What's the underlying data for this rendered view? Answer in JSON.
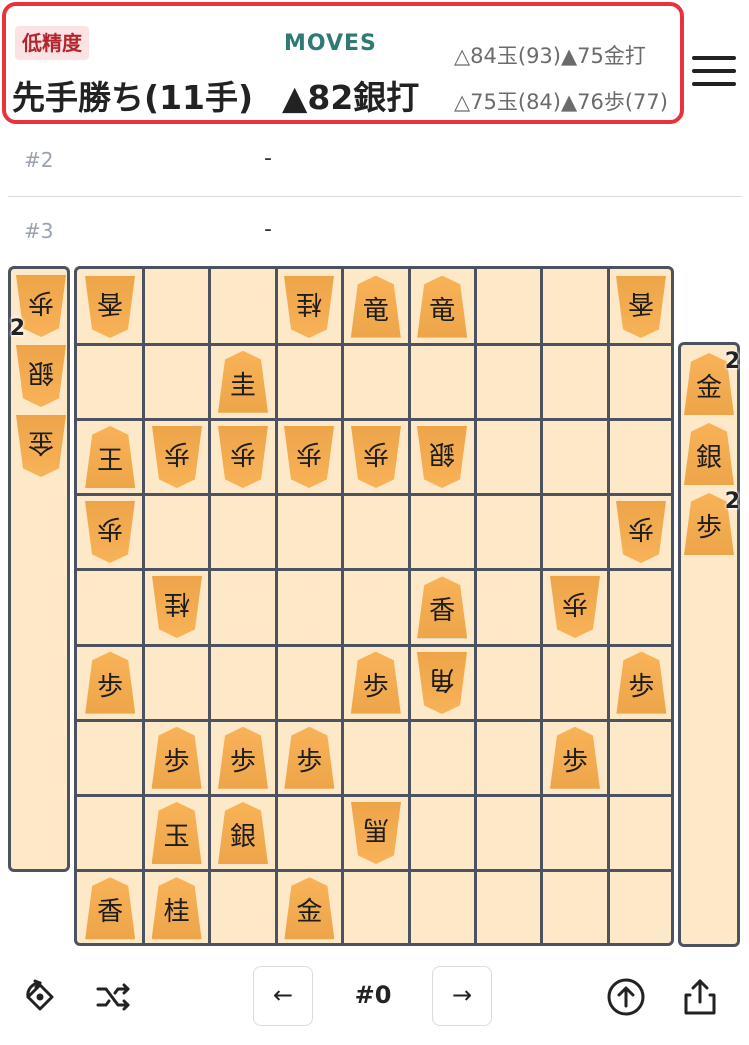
{
  "header": {
    "accuracy_badge": "低精度",
    "result": "先手勝ち(11手)",
    "moves_label": "MOVES",
    "best_move": "▲82銀打",
    "alt_move_1": "△84玉(93)▲75金打",
    "alt_move_2": "△75玉(84)▲76歩(77)"
  },
  "rows": [
    {
      "num": "#2",
      "move": "-"
    },
    {
      "num": "#3",
      "move": "-"
    }
  ],
  "board": {
    "pieces": [
      {
        "file": 1,
        "rank": 1,
        "char": "香",
        "owner": "gote"
      },
      {
        "file": 4,
        "rank": 1,
        "char": "桂",
        "owner": "gote"
      },
      {
        "file": 5,
        "rank": 1,
        "char": "竜",
        "owner": "sente"
      },
      {
        "file": 6,
        "rank": 1,
        "char": "竜",
        "owner": "sente"
      },
      {
        "file": 9,
        "rank": 1,
        "char": "香",
        "owner": "gote"
      },
      {
        "file": 3,
        "rank": 2,
        "char": "圭",
        "owner": "sente"
      },
      {
        "file": 1,
        "rank": 3,
        "char": "王",
        "owner": "sente"
      },
      {
        "file": 2,
        "rank": 3,
        "char": "歩",
        "owner": "gote"
      },
      {
        "file": 3,
        "rank": 3,
        "char": "歩",
        "owner": "gote"
      },
      {
        "file": 4,
        "rank": 3,
        "char": "歩",
        "owner": "gote"
      },
      {
        "file": 5,
        "rank": 3,
        "char": "歩",
        "owner": "gote"
      },
      {
        "file": 6,
        "rank": 3,
        "char": "銀",
        "owner": "gote"
      },
      {
        "file": 1,
        "rank": 4,
        "char": "歩",
        "owner": "gote"
      },
      {
        "file": 9,
        "rank": 4,
        "char": "歩",
        "owner": "gote"
      },
      {
        "file": 2,
        "rank": 5,
        "char": "桂",
        "owner": "gote"
      },
      {
        "file": 6,
        "rank": 5,
        "char": "香",
        "owner": "sente"
      },
      {
        "file": 8,
        "rank": 5,
        "char": "歩",
        "owner": "gote"
      },
      {
        "file": 1,
        "rank": 6,
        "char": "歩",
        "owner": "sente"
      },
      {
        "file": 5,
        "rank": 6,
        "char": "歩",
        "owner": "sente"
      },
      {
        "file": 6,
        "rank": 6,
        "char": "角",
        "owner": "gote"
      },
      {
        "file": 9,
        "rank": 6,
        "char": "歩",
        "owner": "sente"
      },
      {
        "file": 2,
        "rank": 7,
        "char": "歩",
        "owner": "sente"
      },
      {
        "file": 3,
        "rank": 7,
        "char": "歩",
        "owner": "sente"
      },
      {
        "file": 4,
        "rank": 7,
        "char": "歩",
        "owner": "sente"
      },
      {
        "file": 8,
        "rank": 7,
        "char": "歩",
        "owner": "sente"
      },
      {
        "file": 2,
        "rank": 8,
        "char": "玉",
        "owner": "sente"
      },
      {
        "file": 3,
        "rank": 8,
        "char": "銀",
        "owner": "sente"
      },
      {
        "file": 5,
        "rank": 8,
        "char": "馬",
        "owner": "gote"
      },
      {
        "file": 1,
        "rank": 9,
        "char": "香",
        "owner": "sente"
      },
      {
        "file": 2,
        "rank": 9,
        "char": "桂",
        "owner": "sente"
      },
      {
        "file": 4,
        "rank": 9,
        "char": "金",
        "owner": "sente"
      }
    ]
  },
  "gote_hand": [
    {
      "char": "歩",
      "count": "2"
    },
    {
      "char": "銀",
      "count": ""
    },
    {
      "char": "金",
      "count": ""
    }
  ],
  "sente_hand": [
    {
      "char": "金",
      "count": "2"
    },
    {
      "char": "銀",
      "count": ""
    },
    {
      "char": "歩",
      "count": "2"
    }
  ],
  "toolbar": {
    "move_number": "#0",
    "prev_arrow": "←",
    "next_arrow": "→",
    "icons": [
      "flip-board-icon",
      "shuffle-icon",
      "upload-circle-icon",
      "share-icon"
    ]
  },
  "colors": {
    "header_border": "#e8323c",
    "board_bg": "#fde9c7",
    "piece": "#f2aa4f",
    "moves_label": "#2f7a73",
    "grid": "#4d5260"
  }
}
